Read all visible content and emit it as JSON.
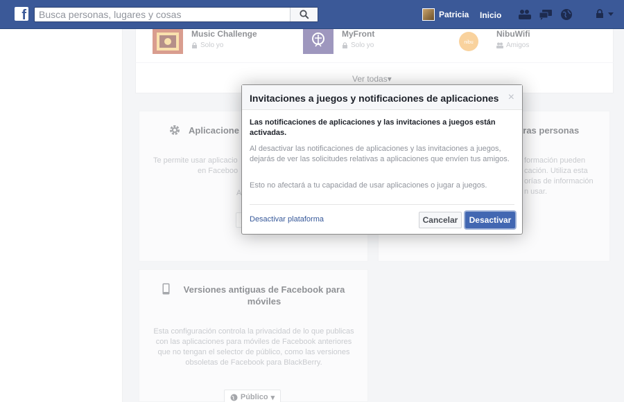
{
  "header": {
    "logo": "f",
    "search_placeholder": "Busca personas, lugares y cosas",
    "user_name": "Patricia",
    "home_label": "Inicio"
  },
  "apps": [
    {
      "name": "Music Challenge",
      "privacy": "Solo yo",
      "icon": "music-challenge-app-icon"
    },
    {
      "name": "MyFront",
      "privacy": "Solo yo",
      "icon": "myfront-app-icon"
    },
    {
      "name": "NibuWifi",
      "privacy": "Amigos",
      "icon": "nibuwifi-app-icon"
    }
  ],
  "see_all": "Ver todas",
  "cards": {
    "apps_title": "Aplicacione",
    "apps_text_1": "Te permite usar aplicacio",
    "apps_text_2": "en Faceboo",
    "apps_text_3": "A",
    "others_title": "otras personas",
    "others_text_1": "formación pueden",
    "others_text_2": "cación. Utiliza esta",
    "others_text_3": "orías de información",
    "others_text_4": "n usar.",
    "mobile_title": "Versiones antiguas de Facebook para móviles",
    "mobile_text": "Esta configuración controla la privacidad de lo que publicas con las aplicaciones para móviles de Facebook anteriores que no tengan el selector de público, como las versiones obsoletas de Facebook para BlackBerry.",
    "audience_label": "Público"
  },
  "dialog": {
    "title": "Invitaciones a juegos y notificaciones de aplicaciones",
    "close": "×",
    "strong_text": "Las notificaciones de aplicaciones y las invitaciones a juegos están activadas.",
    "para1": "Al desactivar las notificaciones de aplicaciones y las invitaciones a juegos, dejarás de ver las solicitudes relativas a aplicaciones que envíen tus amigos.",
    "para2": "Esto no afectará a tu capacidad de usar aplicaciones o jugar a juegos.",
    "deactivate_platform": "Desactivar plataforma",
    "cancel": "Cancelar",
    "deactivate": "Desactivar"
  },
  "colors": {
    "brand": "#3b5998",
    "primary_button": "#4267b2",
    "link": "#365899"
  }
}
